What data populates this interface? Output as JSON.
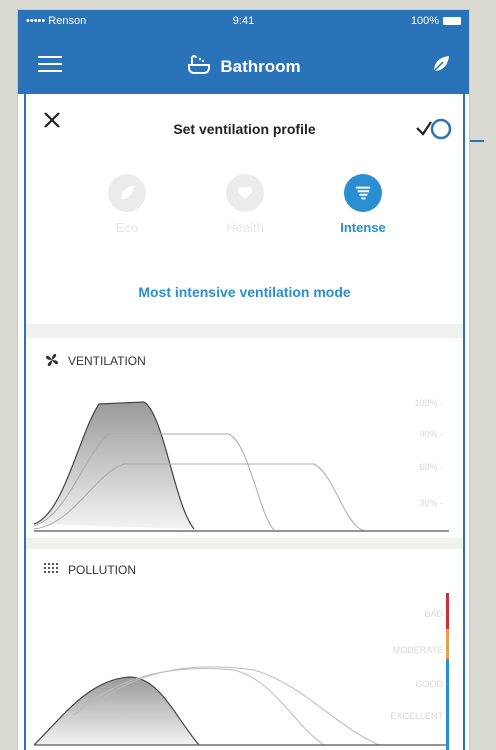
{
  "status": {
    "carrier": "••••• Renson",
    "time": "9:41",
    "battery": "100%"
  },
  "nav": {
    "title": "Bathroom"
  },
  "sheet": {
    "title": "Set ventilation profile",
    "profiles": [
      {
        "label": "Eco",
        "icon": "leaf-icon",
        "active": false
      },
      {
        "label": "Health",
        "icon": "heart-icon",
        "active": false
      },
      {
        "label": "Intense",
        "icon": "tornado-icon",
        "active": true
      }
    ],
    "description": "Most intensive ventilation mode"
  },
  "ventilation": {
    "title": "VENTILATION",
    "levels": [
      "100% -",
      "90% -",
      "60% -",
      "30% -"
    ]
  },
  "pollution": {
    "title": "POLLUTION",
    "levels": [
      "BAD",
      "MODERATE",
      "GOOD",
      "EXCELLENT"
    ]
  },
  "colors": {
    "primary": "#2b73b9",
    "accent": "#2a8fd0",
    "bad": "#c8333a",
    "moderate": "#e8a04e",
    "good": "#2a8fd0"
  }
}
